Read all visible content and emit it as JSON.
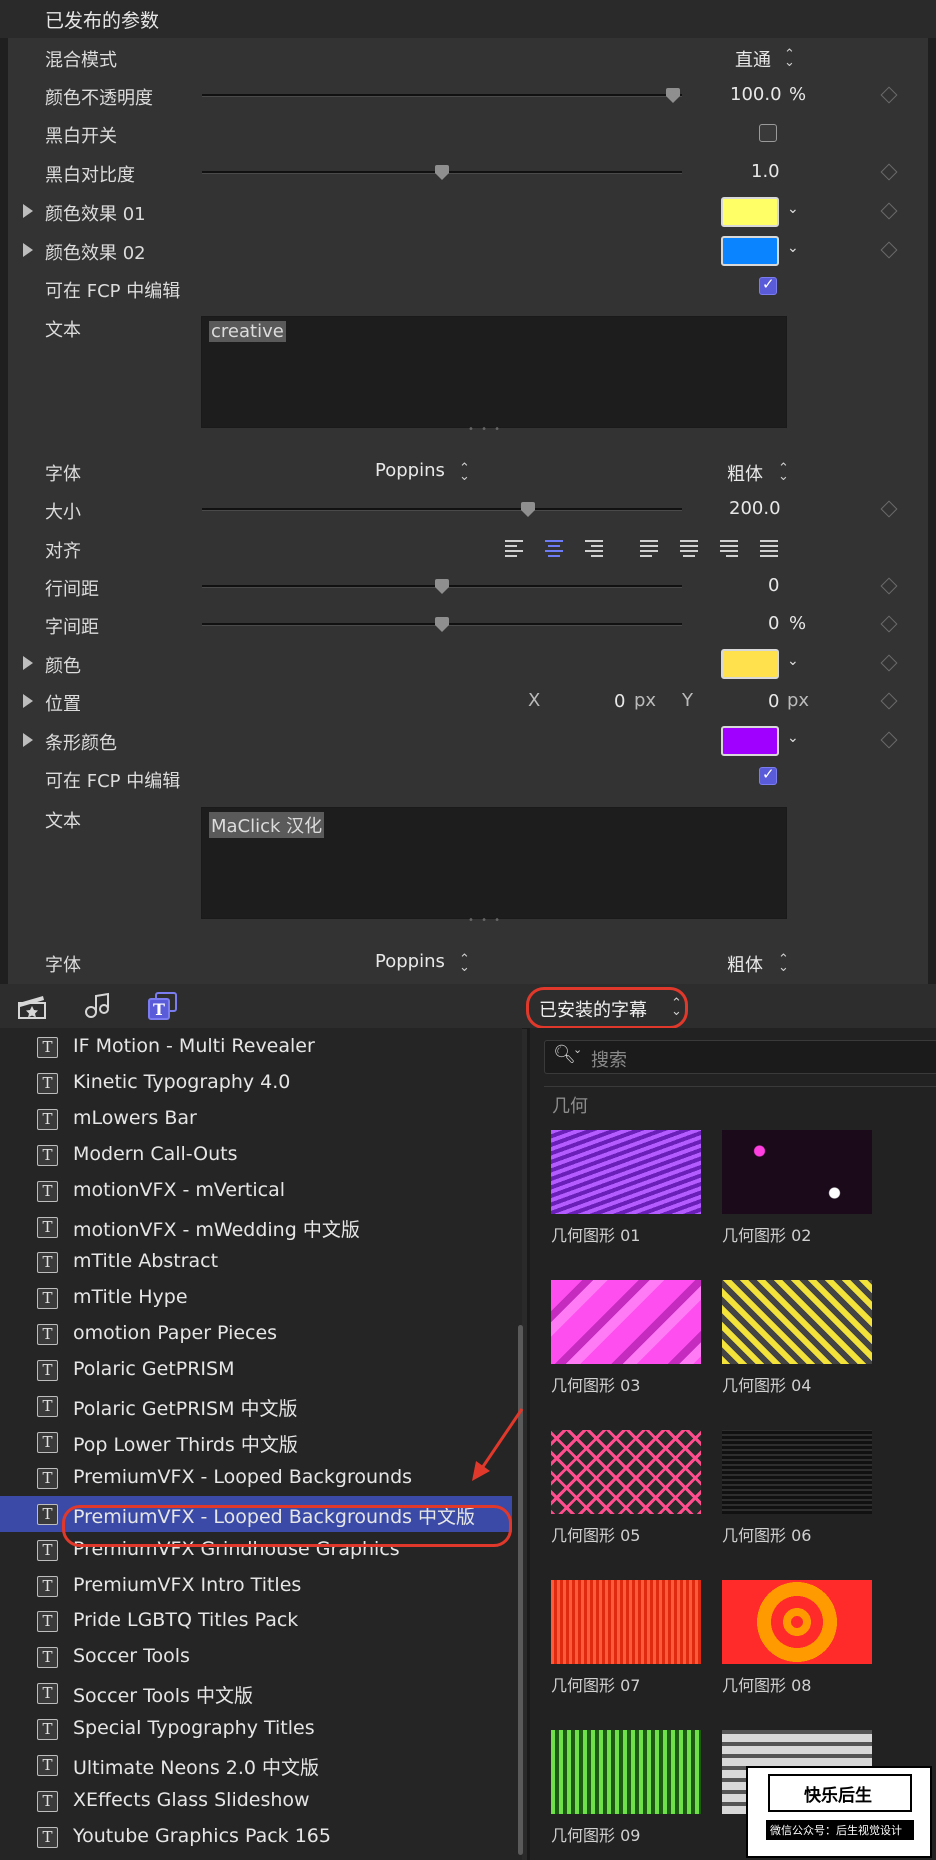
{
  "inspector": {
    "header_title": "已发布的参数",
    "blend_mode": {
      "label": "混合模式",
      "value": "直通"
    },
    "opacity": {
      "label": "颜色不透明度",
      "value": "100.0",
      "unit": "%",
      "level": 1.0
    },
    "bw_switch": {
      "label": "黑白开关",
      "checked": false
    },
    "bw_contrast": {
      "label": "黑白对比度",
      "value": "1.0",
      "level": 0.5
    },
    "color_effect_1": {
      "label": "颜色效果 01",
      "color": "#FFFF66"
    },
    "color_effect_2": {
      "label": "颜色效果 02",
      "color": "#0A84FF"
    },
    "editable_1": {
      "label": "可在 FCP 中编辑",
      "checked": true
    },
    "text_1": {
      "label": "文本",
      "value": "creative"
    },
    "font_1": {
      "label": "字体",
      "family": "Poppins",
      "weight": "粗体"
    },
    "size": {
      "label": "大小",
      "value": "200.0",
      "level": 0.68
    },
    "align": {
      "label": "对齐"
    },
    "line_spacing": {
      "label": "行间距",
      "value": "0",
      "level": 0.5
    },
    "char_spacing": {
      "label": "字间距",
      "value": "0",
      "unit": "%",
      "level": 0.5
    },
    "color": {
      "label": "颜色",
      "color": "#FFE14D"
    },
    "position": {
      "label": "位置",
      "x_label": "X",
      "x": "0",
      "x_unit": "px",
      "y_label": "Y",
      "y": "0",
      "y_unit": "px"
    },
    "bar_color": {
      "label": "条形颜色",
      "color": "#A000FF"
    },
    "editable_2": {
      "label": "可在 FCP 中编辑",
      "checked": true
    },
    "text_2": {
      "label": "文本",
      "value": "MaClick 汉化"
    },
    "font_2": {
      "label": "字体",
      "family": "Poppins",
      "weight": "粗体"
    }
  },
  "toolbar": {
    "dropdown": "已安装的字幕"
  },
  "library": {
    "items": [
      "IF Motion - Multi Revealer",
      "Kinetic Typography 4.0",
      "mLowers Bar",
      "Modern Call-Outs",
      "motionVFX - mVertical",
      "motionVFX - mWedding 中文版",
      "mTitle Abstract",
      "mTitle Hype",
      "omotion Paper Pieces",
      "Polaric GetPRISM",
      "Polaric GetPRISM 中文版",
      "Pop Lower Thirds 中文版",
      "PremiumVFX - Looped Backgrounds",
      "PremiumVFX - Looped Backgrounds 中文版",
      "PremiumVFX Grindhouse Graphics",
      "PremiumVFX Intro Titles",
      "Pride LGBTQ Titles Pack",
      "Soccer Tools",
      "Soccer Tools 中文版",
      "Special Typography Titles",
      "Ultimate Neons 2.0 中文版",
      "XEffects Glass Slideshow",
      "Youtube Graphics Pack 165"
    ],
    "selected_index": 13
  },
  "browser": {
    "search_placeholder": "搜索",
    "category": "几何",
    "tiles": [
      "几何图形 01",
      "几何图形 02",
      "几何图形 03",
      "几何图形 04",
      "几何图形 05",
      "几何图形 06",
      "几何图形 07",
      "几何图形 08",
      "几何图形 09",
      ""
    ]
  },
  "watermark": {
    "line1": "快乐后生",
    "line2": "微信公众号：后生视觉设计"
  },
  "colors": {
    "accent": "#5A5BD8",
    "selection": "#3A4AA6",
    "annotation_red": "#E0392B"
  }
}
